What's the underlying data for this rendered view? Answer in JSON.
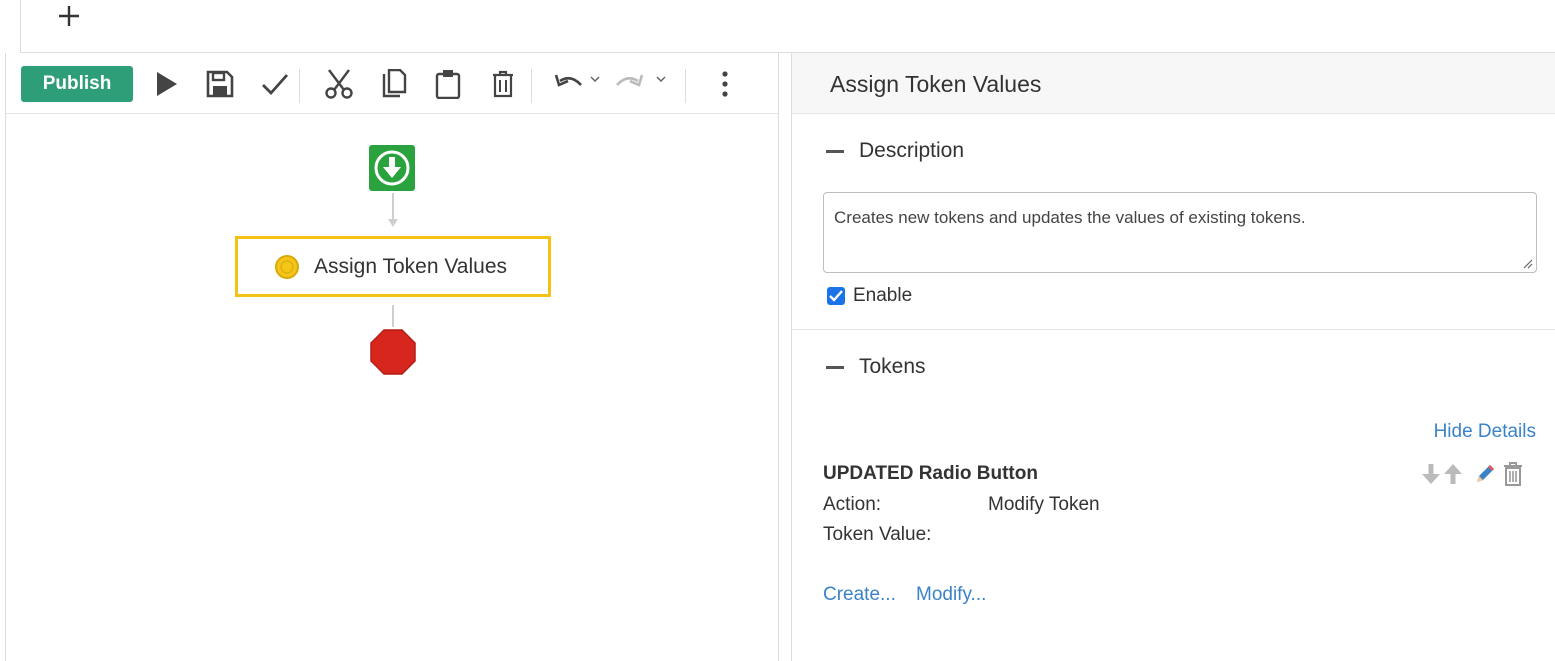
{
  "topbar": {
    "add_icon": "plus-icon"
  },
  "toolbar": {
    "publish_label": "Publish",
    "icons": [
      "play-icon",
      "save-icon",
      "check-icon",
      "cut-icon",
      "copy-icon",
      "paste-icon",
      "delete-icon",
      "undo-icon",
      "redo-icon",
      "more-vertical-icon"
    ]
  },
  "workflow": {
    "start_icon": "download-arrow-icon",
    "task_label": "Assign Token Values",
    "task_icon": "coin-icon",
    "stop_icon": "stop-sign-icon",
    "selected_color": "#f2c314"
  },
  "panel": {
    "title": "Assign Token Values",
    "description_section": {
      "title": "Description",
      "text": "Creates new tokens and updates the values of existing tokens.",
      "enable_label": "Enable",
      "enabled": true
    },
    "tokens_section": {
      "title": "Tokens",
      "hide_details_label": "Hide Details",
      "token": {
        "name": "UPDATED Radio Button",
        "action_label": "Action:",
        "action_value": "Modify Token",
        "token_value_label": "Token Value:",
        "token_value": ""
      },
      "create_link": "Create...",
      "modify_link": "Modify..."
    }
  },
  "colors": {
    "publish": "#2e9e79",
    "start": "#2aa33f",
    "stop": "#d7261e",
    "link": "#3a83c9"
  }
}
